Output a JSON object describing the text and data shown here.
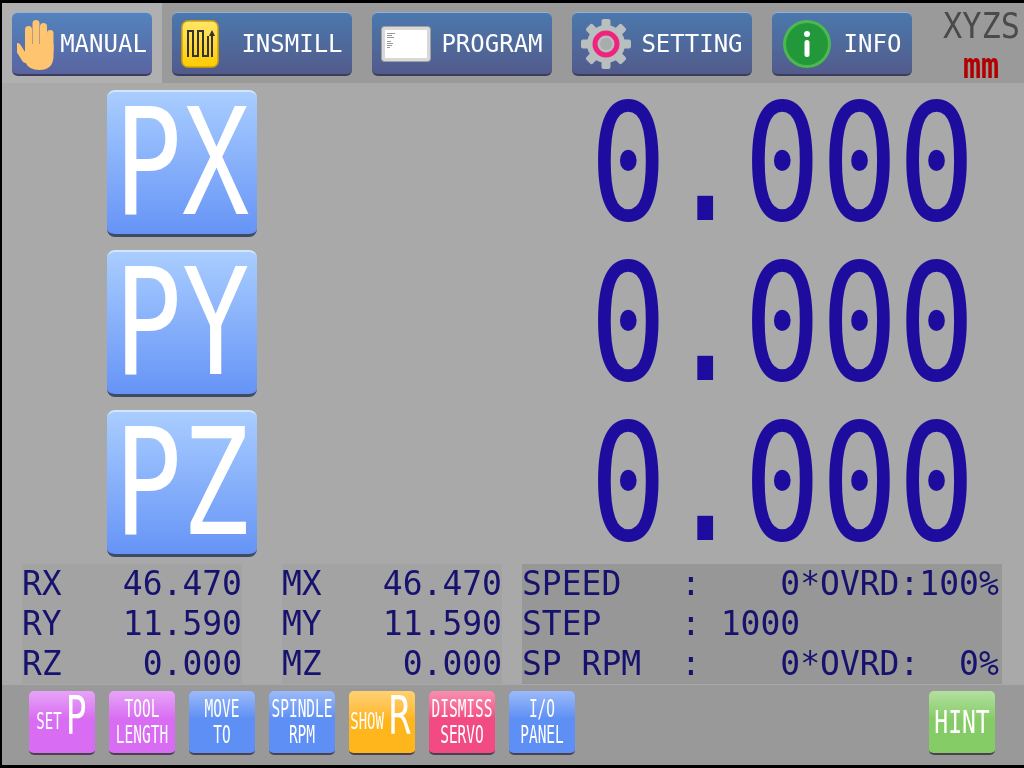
{
  "tabs": [
    {
      "label": "MANUAL",
      "selected": true
    },
    {
      "label": "INSMILL",
      "selected": false
    },
    {
      "label": "PROGRAM",
      "selected": false
    },
    {
      "label": "SETTING",
      "selected": false
    },
    {
      "label": "INFO",
      "selected": false
    }
  ],
  "mode_indicator": {
    "axes": "XYZS",
    "unit": "mm"
  },
  "axes": [
    {
      "button": "PX",
      "value": "0.000"
    },
    {
      "button": "PY",
      "value": "0.000"
    },
    {
      "button": "PZ",
      "value": "0.000"
    }
  ],
  "relative_position": [
    {
      "label": "RX",
      "value": "46.470"
    },
    {
      "label": "RY",
      "value": "11.590"
    },
    {
      "label": "RZ",
      "value": "0.000"
    }
  ],
  "machine_position": [
    {
      "label": "MX",
      "value": "46.470"
    },
    {
      "label": "MY",
      "value": "11.590"
    },
    {
      "label": "MZ",
      "value": "0.000"
    }
  ],
  "status": [
    "SPEED   :    0*OVRD:100%",
    "STEP    : 1000",
    "SP RPM  :    0*OVRD:  0%"
  ],
  "actions": [
    {
      "kind": "prefixed",
      "prefix": "SET",
      "letter": "P",
      "color": "#d86cf2"
    },
    {
      "kind": "stacked",
      "lines": [
        "TOOL",
        "LENGTH"
      ],
      "color": "#d86cf2"
    },
    {
      "kind": "stacked",
      "lines": [
        "MOVE",
        "TO"
      ],
      "color": "#5e8ff4"
    },
    {
      "kind": "stacked",
      "lines": [
        "SPINDLE",
        "RPM"
      ],
      "color": "#5e8ff4"
    },
    {
      "kind": "prefixed",
      "prefix": "SHOW",
      "letter": "R",
      "color": "#ffb61c"
    },
    {
      "kind": "stacked",
      "lines": [
        "DISMISS",
        "SERVO"
      ],
      "color": "#f24a82"
    },
    {
      "kind": "stacked",
      "lines": [
        "I/O",
        "PANEL"
      ],
      "color": "#5e8ff4"
    }
  ],
  "hint_button": {
    "label": "HINT"
  }
}
